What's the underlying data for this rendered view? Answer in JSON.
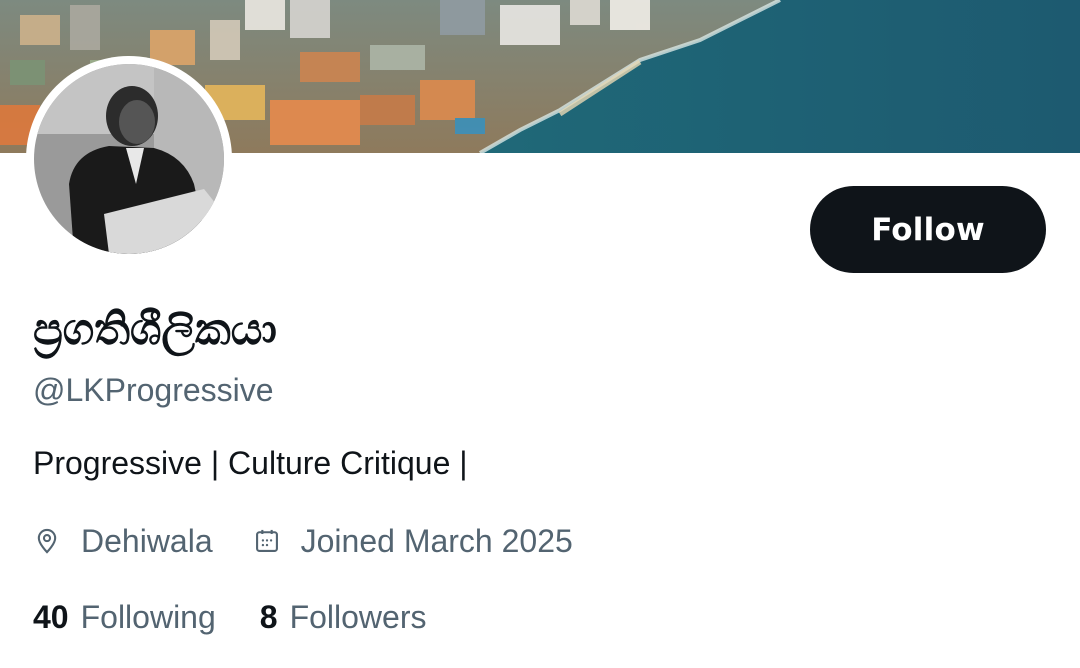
{
  "profile": {
    "display_name": "ප්‍රගතිශීලිකයා",
    "handle": "@LKProgressive",
    "bio": "Progressive | Culture Critique |",
    "location": "Dehiwala",
    "joined": "Joined March 2025",
    "following_count": "40",
    "following_label": "Following",
    "followers_count": "8",
    "followers_label": "Followers"
  },
  "actions": {
    "follow_label": "Follow"
  },
  "icons": {
    "location": "location-pin-icon",
    "joined": "calendar-icon"
  },
  "colors": {
    "primary_text": "#0f1419",
    "secondary_text": "#536471",
    "button_bg": "#0f1419",
    "button_text": "#ffffff"
  }
}
